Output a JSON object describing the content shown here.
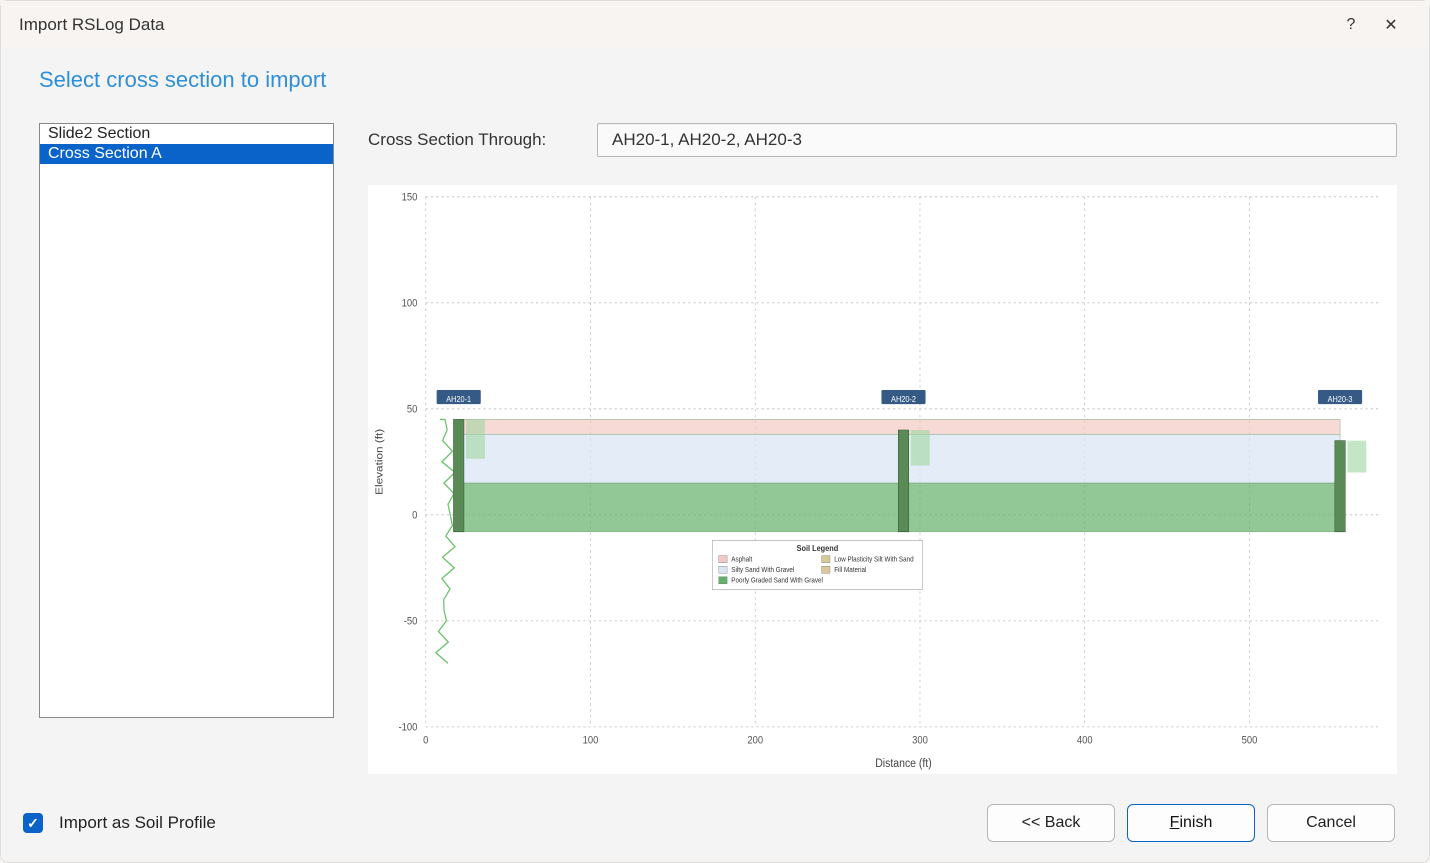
{
  "window": {
    "title": "Import RSLog Data",
    "help_glyph": "?",
    "close_glyph": "✕"
  },
  "heading": "Select cross section to import",
  "sections_list": {
    "items": [
      {
        "label": "Slide2 Section",
        "selected": false
      },
      {
        "label": "Cross Section A",
        "selected": true
      }
    ]
  },
  "through": {
    "label": "Cross Section Through:",
    "value": "AH20-1, AH20-2, AH20-3"
  },
  "footer": {
    "checkbox_label": "Import as Soil Profile",
    "checkbox_checked": true,
    "back_label": "<< Back",
    "finish_label_pre": "",
    "finish_label_mn": "F",
    "finish_label_post": "inish",
    "cancel_label": "Cancel"
  },
  "chart_data": {
    "type": "cross-section",
    "title": "",
    "xlabel": "Distance (ft)",
    "ylabel": "Elevation (ft)",
    "xlim": [
      0,
      580
    ],
    "ylim": [
      -100,
      150
    ],
    "x_ticks": [
      0,
      100,
      200,
      300,
      400,
      500
    ],
    "y_ticks": [
      -100,
      -50,
      0,
      50,
      100,
      150
    ],
    "boreholes": [
      {
        "name": "AH20-1",
        "x": 20,
        "top_elev": 45
      },
      {
        "name": "AH20-2",
        "x": 290,
        "top_elev": 40
      },
      {
        "name": "AH20-3",
        "x": 555,
        "top_elev": 35
      }
    ],
    "layers": [
      {
        "name": "Asphalt",
        "color": "#f3c9c5",
        "top_elev": 45,
        "bottom_elev": 38
      },
      {
        "name": "Silty Sand With Gravel",
        "color": "#d8e5f4",
        "top_elev": 38,
        "bottom_elev": 15
      },
      {
        "name": "Poorly Graded Sand With Gravel",
        "color": "#63b06a",
        "top_elev": 15,
        "bottom_elev": -8
      }
    ],
    "legend": {
      "title": "Soil Legend",
      "items_col1": [
        "Asphalt",
        "Silty Sand With Gravel",
        "Poorly Graded Sand With Gravel"
      ],
      "items_col2": [
        "Low Plasticity Silt With Sand",
        "Fill Material"
      ]
    }
  }
}
